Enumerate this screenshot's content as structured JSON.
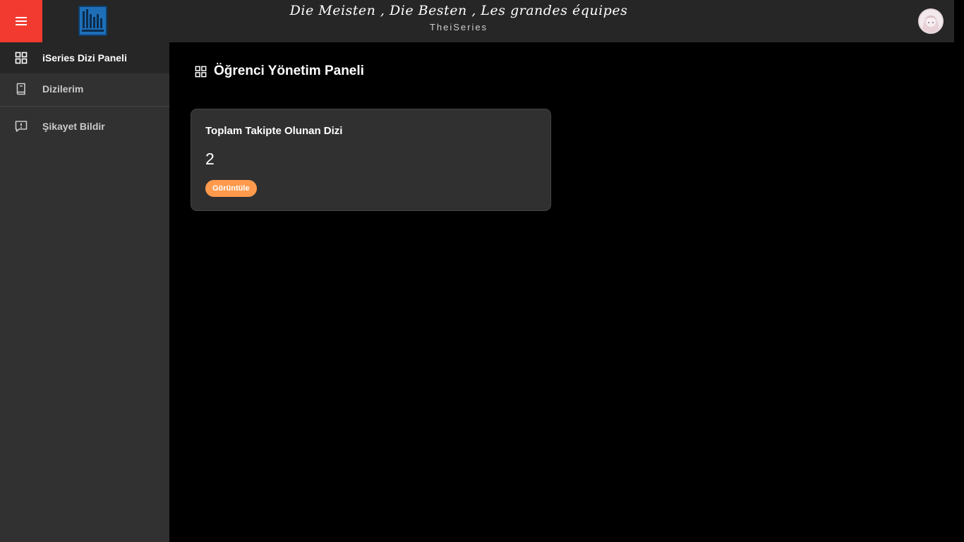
{
  "header": {
    "slogan": "Die Meisten , Die Besten , Les grandes équipes",
    "brand": "TheiSeries",
    "menu_icon": "hamburger-icon",
    "menu_color": "#f23a30"
  },
  "sidebar": {
    "items": [
      {
        "label": "iSeries Dizi Paneli",
        "icon": "dashboard-grid-icon",
        "active": true
      },
      {
        "label": "Dizilerim",
        "icon": "book-icon",
        "active": false
      },
      {
        "label": "Şikayet Bildir",
        "icon": "report-icon",
        "active": false
      }
    ]
  },
  "main": {
    "title": "Öğrenci Yönetim Paneli",
    "title_icon": "dashboard-grid-icon",
    "card": {
      "title": "Toplam Takipte Olunan Dizi",
      "value": "2",
      "button_label": "Görüntüle",
      "button_color": "#ff9a4d"
    }
  }
}
